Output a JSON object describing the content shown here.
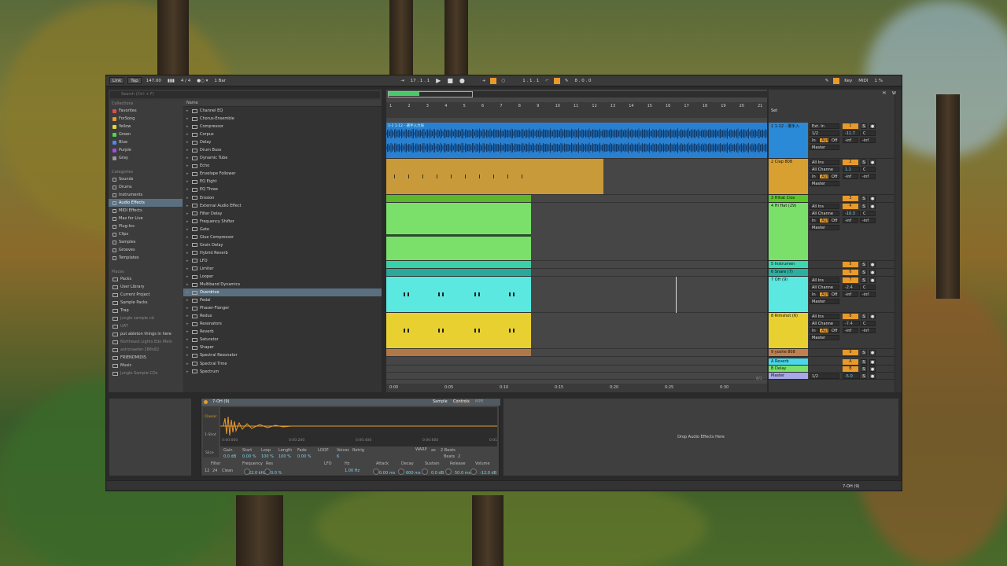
{
  "transport": {
    "link": "Link",
    "tap": "Tap",
    "tempo": "147.00",
    "signature": "4 / 4",
    "quantize": "1 Bar",
    "position": "17 .  1 .  1",
    "loop_start": "1 .  1 .  1",
    "loop_length": "8 .  0 .  0",
    "key": "Key",
    "midi": "MIDI",
    "cpu": "1 %",
    "h": "H",
    "w": "W"
  },
  "browser": {
    "search_placeholder": "Search (Ctrl + F)",
    "collections_title": "Collections",
    "collections": [
      {
        "label": "Favorites",
        "color": "#e84a4a"
      },
      {
        "label": "ForSong",
        "color": "#e89a2a"
      },
      {
        "label": "Yellow",
        "color": "#e8d82a"
      },
      {
        "label": "Green",
        "color": "#4ad84a"
      },
      {
        "label": "Blue",
        "color": "#4a8ae8"
      },
      {
        "label": "Purple",
        "color": "#a84ae8"
      },
      {
        "label": "Gray",
        "color": "#9a9a9a"
      }
    ],
    "categories_title": "Categories",
    "categories": [
      "Sounds",
      "Drums",
      "Instruments",
      "Audio Effects",
      "MIDI Effects",
      "Max for Live",
      "Plug-Ins",
      "Clips",
      "Samples",
      "Grooves",
      "Templates"
    ],
    "selected_category": "Audio Effects",
    "places_title": "Places",
    "places": [
      "Packs",
      "User Library",
      "Current Project",
      "Sample Packs",
      "Trap",
      "jungle sample cd",
      "UAT",
      "put ableton things in here",
      "Northeast Lights Edo Melo",
      "astronaefer-188n82",
      "FRIENDMIDIS",
      "Music",
      "Jungle Sample CDs"
    ],
    "dim_places": [
      "jungle sample cd",
      "UAT",
      "Northeast Lights Edo Melo",
      "astronaefer-188n82",
      "Jungle Sample CDs"
    ],
    "name_header": "Name",
    "items": [
      "Channel EQ",
      "Chorus-Ensemble",
      "Compressor",
      "Corpus",
      "Delay",
      "Drum Buss",
      "Dynamic Tube",
      "Echo",
      "Envelope Follower",
      "EQ Eight",
      "EQ Three",
      "Erosion",
      "External Audio Effect",
      "Filter Delay",
      "Frequency Shifter",
      "Gate",
      "Glue Compressor",
      "Grain Delay",
      "Hybrid Reverb",
      "LFO",
      "Limiter",
      "Looper",
      "Multiband Dynamics",
      "Overdrive",
      "Pedal",
      "Phaser-Flanger",
      "Redux",
      "Resonators",
      "Reverb",
      "Saturator",
      "Shaper",
      "Spectral Resonator",
      "Spectral Time",
      "Spectrum"
    ],
    "selected_item": "Overdrive"
  },
  "arrangement": {
    "bars": [
      "1",
      "2",
      "3",
      "4",
      "5",
      "6",
      "7",
      "8",
      "9",
      "10",
      "11",
      "12",
      "13",
      "14",
      "15",
      "16",
      "17",
      "18",
      "19",
      "20",
      "21"
    ],
    "times": [
      "0:00",
      "0:05",
      "0:10",
      "0:15",
      "0:20",
      "0:25",
      "0:30"
    ],
    "clip_label_1": "1-1 1-12 - 選手入力局",
    "page_indicator": "8/1"
  },
  "mixer": {
    "set_label": "Set",
    "tracks": [
      {
        "name": "1 1-12 - 選手入",
        "color": "#2a8ad8",
        "input": "Ext. In",
        "sub": "1/2",
        "out": "Master",
        "num": "1",
        "vol": "-11.7",
        "pan": "C",
        "a": "-inf",
        "b": "-inf"
      },
      {
        "name": "2 Clap 808",
        "color": "#d8a030",
        "input": "All Ins",
        "sub": "All Channe",
        "out": "Master",
        "num": "2",
        "vol": "1.1",
        "pan": "C",
        "a": "-inf",
        "b": "-inf"
      },
      {
        "name": "3 Hihat Clos",
        "color": "#5ac82a",
        "num": "3"
      },
      {
        "name": "4 Hi Hat (29)",
        "color": "#7ae06a",
        "input": "All Ins",
        "sub": "All Channe",
        "out": "Master",
        "num": "4",
        "vol": "-10.3",
        "pan": "C",
        "a": "-inf",
        "b": "-inf"
      },
      {
        "name": "5 Instrumen",
        "color": "#3ad8b0",
        "num": "5"
      },
      {
        "name": "6 Snare (7)",
        "color": "#2ab0a0",
        "num": "6"
      },
      {
        "name": "7 OH (9)",
        "color": "#5ae8e0",
        "input": "All Ins",
        "sub": "All Channe",
        "out": "Master",
        "num": "7",
        "vol": "-2.4",
        "pan": "C",
        "a": "-inf",
        "b": "-inf"
      },
      {
        "name": "8 Rimshot (6)",
        "color": "#e8d030",
        "input": "All Ins",
        "sub": "All Channe",
        "out": "Master",
        "num": "8",
        "vol": "-7.4",
        "pan": "C",
        "a": "-inf",
        "b": "-inf"
      },
      {
        "name": "9 yoshe 808",
        "color": "#c08050",
        "num": "9"
      },
      {
        "name": "A Reverb",
        "color": "#4ad8e8",
        "num": "A"
      },
      {
        "name": "B Delay",
        "color": "#7ae06a",
        "num": "B"
      },
      {
        "name": "Master",
        "color": "#a8a8e8",
        "sub": "1/2",
        "num": "0",
        "vol": "-5.0"
      }
    ],
    "record_label": "Rec",
    "in_label": "In",
    "auto_label": "Auto",
    "off_label": "Off",
    "solo_label": "S"
  },
  "device": {
    "name": "7-OH (9)",
    "tab_sample": "Sample",
    "tab_controls": "Controls",
    "tab_mpe": "MPE",
    "mode_classic": "Classic",
    "mode_1shot": "1-Shot",
    "mode_slice": "Slice",
    "time_labels": [
      "0:00:000",
      "0:00:200",
      "0:00:400",
      "0:00:600",
      "0:01"
    ],
    "params": {
      "gain_label": "Gain",
      "gain": "0.0 dB",
      "start_label": "Start",
      "start": "0.00 %",
      "loop_label": "Loop",
      "loop": "100 %",
      "length_label": "Length",
      "length": "100 %",
      "fade_label": "Fade",
      "fade": "0.00 %",
      "loop_btn": "LOOP",
      "voices_label": "Voices",
      "voices": "6",
      "retrig_label": "Retrig",
      "warp": "WARP",
      "as": "as",
      "beats_val": "2 Beats",
      "beats": "Beats",
      "beats_num": "2",
      "filter_label": "Filter",
      "filter_num_a": "12",
      "filter_num_b": "24",
      "filter_type": "Clean",
      "freq_label": "Frequency",
      "freq": "22.0 kHz",
      "res_label": "Res",
      "res": "0.0 %",
      "lfo_label": "LFO",
      "lfo_hz": "Hz",
      "lfo_rate": "1.00 Hz",
      "attack_label": "Attack",
      "attack": "0.00 ms",
      "decay_label": "Decay",
      "decay": "600 ms",
      "sustain_label": "Sustain",
      "sustain": "0.0 dB",
      "release_label": "Release",
      "release": "50.0 ms",
      "volume_label": "Volume",
      "volume": "-12.0 dB"
    }
  },
  "drop_zone": "Drop Audio Effects Here",
  "status": {
    "track": "7-OH (9)"
  }
}
